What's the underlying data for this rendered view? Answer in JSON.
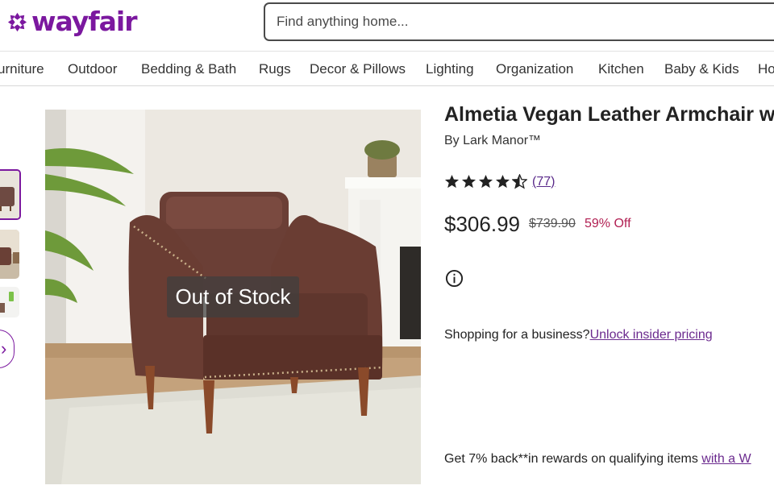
{
  "header": {
    "logo_text": "wayfair",
    "brand_color": "#7b189f",
    "search_placeholder": "Find anything home..."
  },
  "nav": {
    "items": [
      "urniture",
      "Outdoor",
      "Bedding & Bath",
      "Rugs",
      "Decor & Pillows",
      "Lighting",
      "Organization",
      "Kitchen",
      "Baby & Kids",
      "Ho"
    ]
  },
  "gallery": {
    "overlay_text": "Out of Stock",
    "active_thumb_color": "#7b189f"
  },
  "product": {
    "title": "Almetia Vegan Leather Armchair w",
    "brand": "By Lark Manor™",
    "rating": 4.5,
    "review_count": "(77)",
    "price": "$306.99",
    "original_price": "$739.90",
    "discount": "59% Off",
    "discount_color": "#b11f52",
    "business_text": "Shopping for a business?",
    "business_link": "Unlock insider pricing",
    "rewards_text": "Get 7% back**in rewards on qualifying items ",
    "rewards_link": "with a W"
  }
}
